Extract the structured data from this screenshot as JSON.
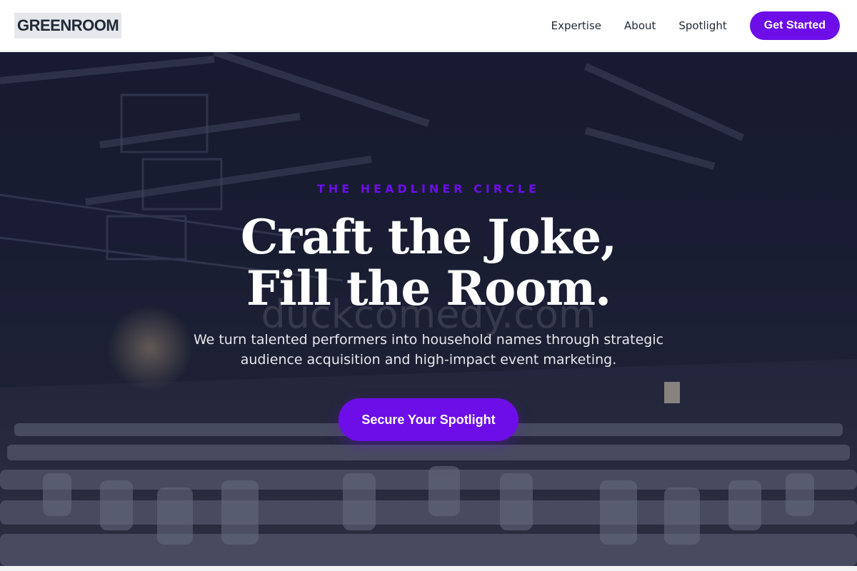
{
  "header": {
    "logo": "GREENROOM",
    "nav": [
      {
        "label": "Expertise"
      },
      {
        "label": "About"
      },
      {
        "label": "Spotlight"
      }
    ],
    "cta_label": "Get Started"
  },
  "hero": {
    "eyebrow": "THE HEADLINER CIRCLE",
    "headline_line1": "Craft the Joke,",
    "headline_line2": "Fill the Room.",
    "watermark": "duckcomedy.com",
    "subtext": "We turn talented performers into household names through strategic audience acquisition and high-impact event marketing.",
    "cta_label": "Secure Your Spotlight",
    "background_image": "empty-auditorium-with-covered-chairs"
  },
  "colors": {
    "accent": "#6d0ee8",
    "nav_bg": "#ffffff",
    "hero_overlay": "#1c2036"
  }
}
